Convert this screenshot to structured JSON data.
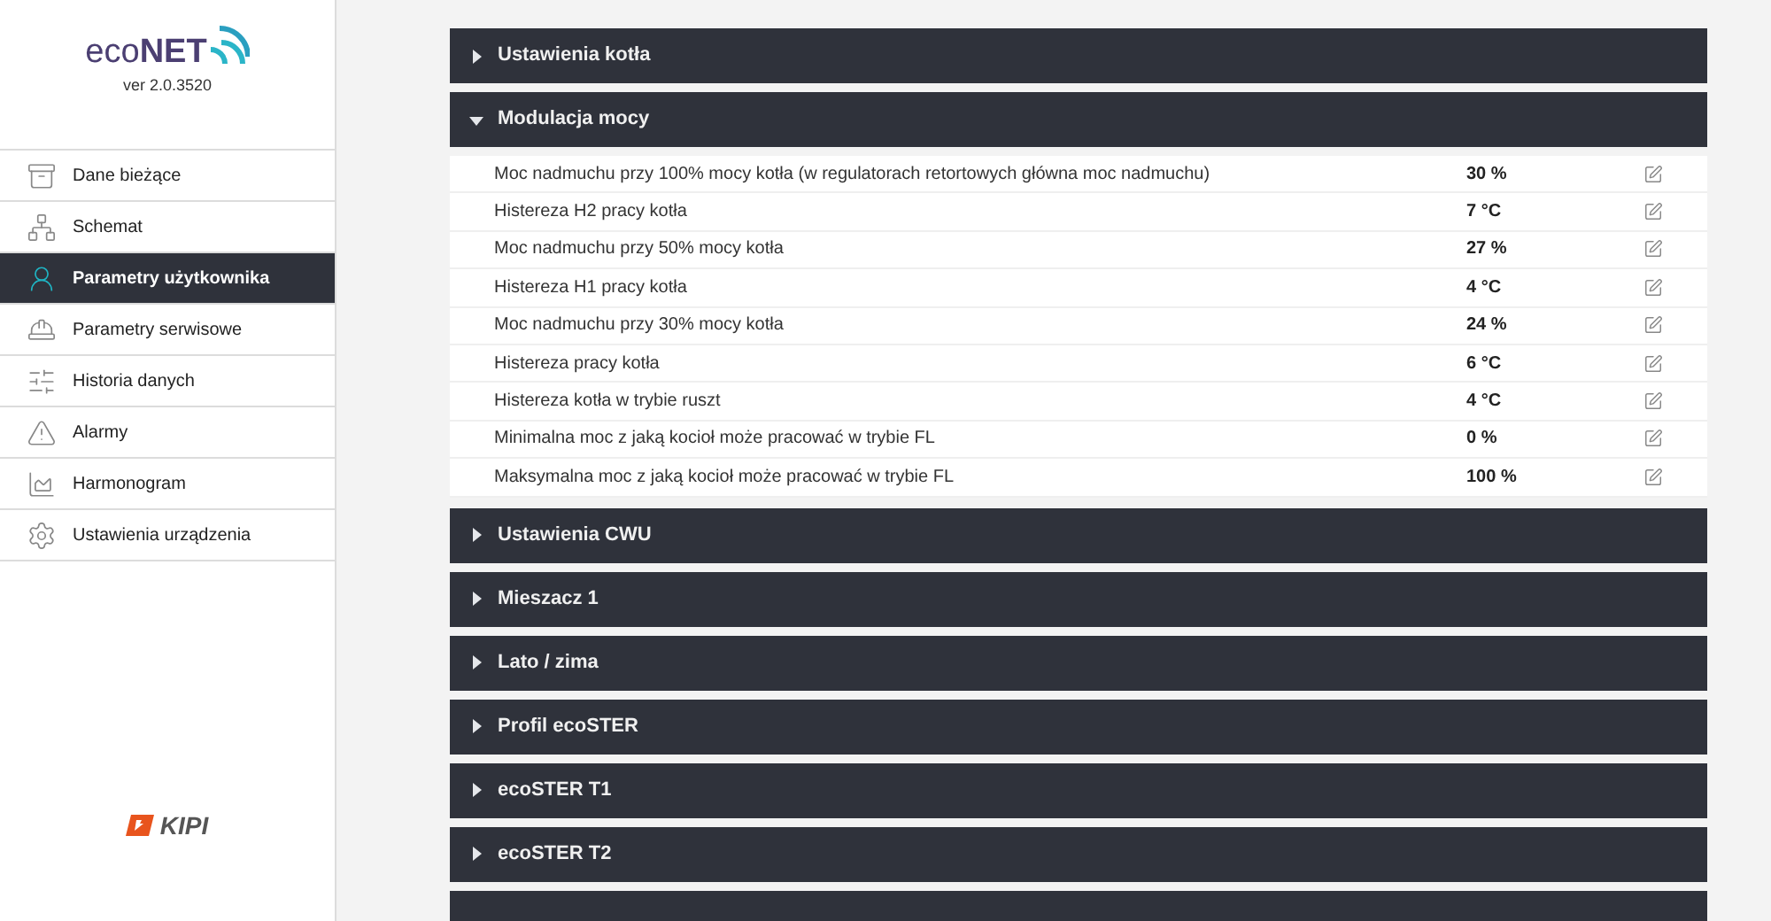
{
  "sidebar": {
    "logo": {
      "brand_light": "eco",
      "brand_bold": "NET",
      "version": "ver 2.0.3520"
    },
    "items": [
      {
        "label": "Dane bieżące",
        "selected": false
      },
      {
        "label": "Schemat",
        "selected": false
      },
      {
        "label": "Parametry użytkownika",
        "selected": true
      },
      {
        "label": "Parametry serwisowe",
        "selected": false
      },
      {
        "label": "Historia danych",
        "selected": false
      },
      {
        "label": "Alarmy",
        "selected": false
      },
      {
        "label": "Harmonogram",
        "selected": false
      },
      {
        "label": "Ustawienia urządzenia",
        "selected": false
      }
    ],
    "footer_logo": "KIPI"
  },
  "sections": [
    {
      "title": "Ustawienia kotła",
      "expanded": false
    },
    {
      "title": "Modulacja mocy",
      "expanded": true,
      "rows": [
        {
          "name": "Moc nadmuchu przy 100% mocy kotła (w regulatorach retortowych główna moc nadmuchu)",
          "value": "30 %"
        },
        {
          "name": "Histereza H2 pracy kotła",
          "value": "7 °C"
        },
        {
          "name": "Moc nadmuchu przy 50% mocy kotła",
          "value": "27 %"
        },
        {
          "name": "Histereza H1 pracy kotła",
          "value": "4 °C"
        },
        {
          "name": "Moc nadmuchu przy 30% mocy kotła",
          "value": "24 %"
        },
        {
          "name": "Histereza pracy kotła",
          "value": "6 °C"
        },
        {
          "name": "Histereza kotła w trybie ruszt",
          "value": "4 °C"
        },
        {
          "name": "Minimalna moc z jaką kocioł może pracować w trybie FL",
          "value": "0 %"
        },
        {
          "name": "Maksymalna moc z jaką kocioł może pracować w trybie FL",
          "value": "100 %"
        }
      ]
    },
    {
      "title": "Ustawienia CWU",
      "expanded": false
    },
    {
      "title": "Mieszacz 1",
      "expanded": false
    },
    {
      "title": "Lato / zima",
      "expanded": false
    },
    {
      "title": "Profil ecoSTER",
      "expanded": false
    },
    {
      "title": "ecoSTER T1",
      "expanded": false
    },
    {
      "title": "ecoSTER T2",
      "expanded": false
    }
  ]
}
